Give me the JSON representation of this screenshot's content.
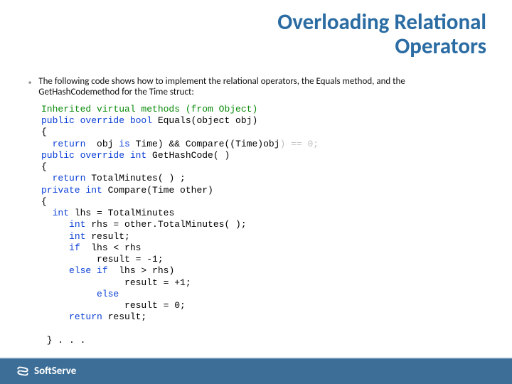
{
  "title_line1": "Overloading Relational",
  "title_line2": "Operators",
  "intro": "The following code shows how to implement the relational operators, the  Equals method, and the GetHashCodemethod for the Time struct:",
  "bullet": "▪",
  "code": {
    "l1": "Inherited virtual methods (from Object)",
    "l2a": "public override bool",
    "l2b": " Equals(object obj)",
    "l3": "{",
    "l4a": "  ",
    "l4b": "return",
    "l4c": "  obj ",
    "l4d": "is",
    "l4e": " Time) && Compare((Time)obj",
    "l4f": ") == 0;",
    "l5a": "public override int",
    "l5b": " GetHashCode( )",
    "l6": "{",
    "l7a": "  ",
    "l7b": "return",
    "l7c": " TotalMinutes( ) ;",
    "l8a": "private int",
    "l8b": " Compare(Time other)",
    "l9": "{",
    "l10a": "  ",
    "l10b": "int",
    "l10c": " lhs = TotalMinutes",
    "l11a": "     ",
    "l11b": "int",
    "l11c": " rhs = other.TotalMinutes( );",
    "l12a": "     ",
    "l12b": "int",
    "l12c": " result;",
    "l13a": "     ",
    "l13b": "if",
    "l13c": "  lhs < rhs",
    "l14": "          result = -1;",
    "l15a": "     ",
    "l15b": "else if",
    "l15c": "  lhs > rhs)",
    "l16": "               result = +1;",
    "l17a": "          ",
    "l17b": "else",
    "l18": "               result = 0;",
    "l19a": "     ",
    "l19b": "return",
    "l19c": " result;",
    "l20": " } . . ."
  },
  "brand": "SoftServe"
}
